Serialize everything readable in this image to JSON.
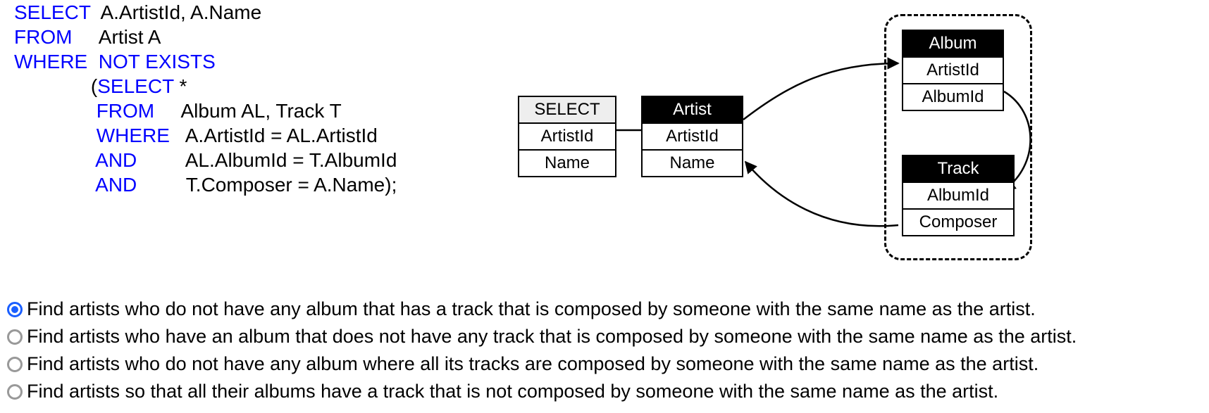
{
  "sql": {
    "line1_kw": "SELECT",
    "line1_txt": "A.ArtistId, A.Name",
    "line2_kw": "FROM",
    "line2_txt": "Artist A",
    "line3_kw": "WHERE",
    "line3_kw2": "NOT EXISTS",
    "line4_paren": "(",
    "line4_kw": "SELECT",
    "line4_txt": "*",
    "line5_kw": "FROM",
    "line5_txt": "Album AL, Track T",
    "line6_kw": "WHERE",
    "line6_txt": "A.ArtistId = AL.ArtistId",
    "line7_kw": "AND",
    "line7_txt": "AL.AlbumId = T.AlbumId",
    "line8_kw": "AND",
    "line8_txt": "T.Composer = A.Name);"
  },
  "diagram": {
    "select": {
      "header": "SELECT",
      "c1": "ArtistId",
      "c2": "Name"
    },
    "artist": {
      "header": "Artist",
      "c1": "ArtistId",
      "c2": "Name"
    },
    "album": {
      "header": "Album",
      "c1": "ArtistId",
      "c2": "AlbumId"
    },
    "track": {
      "header": "Track",
      "c1": "AlbumId",
      "c2": "Composer"
    }
  },
  "options": {
    "o1": "Find artists who do not have any album that has a track that is composed by someone with the same name as the artist.",
    "o2": "Find artists who have an album that does not have any track that is composed by someone with the same name as the artist.",
    "o3": "Find artists who do not have any album where all its tracks are composed by someone with the same name as the artist.",
    "o4": "Find artists so that all their albums have a track that is not composed by someone with the same name as the artist.",
    "selected_index": 0
  }
}
